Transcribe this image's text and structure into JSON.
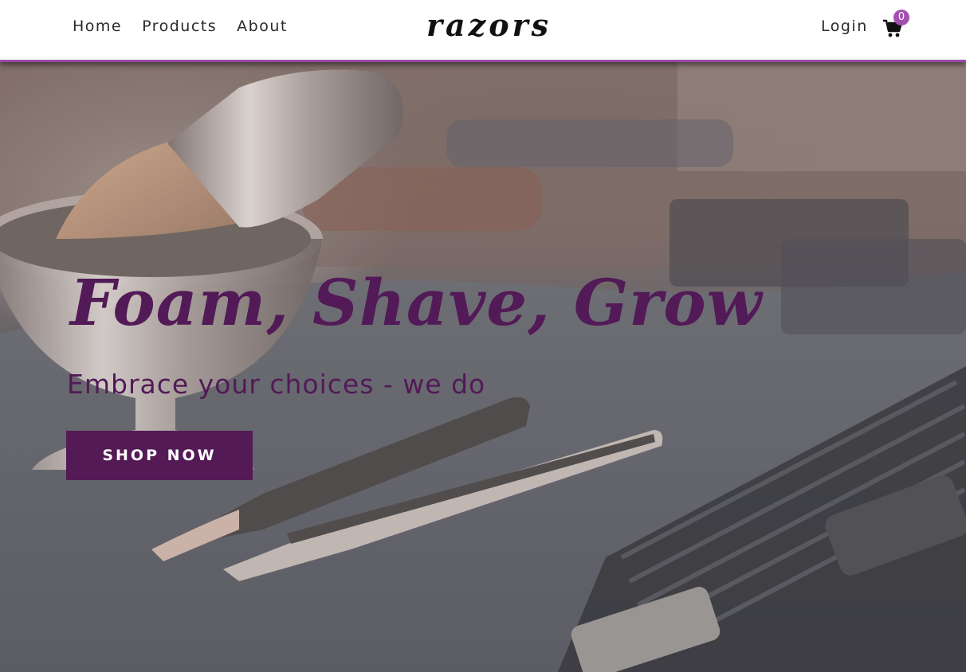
{
  "nav": {
    "links": [
      "Home",
      "Products",
      "About"
    ],
    "brand": "razors",
    "login": "Login",
    "cart_count": "0"
  },
  "hero": {
    "headline": "Foam, Shave, Grow",
    "subheadline": "Embrace your choices - we do",
    "cta": "SHOP NOW"
  },
  "colors": {
    "accent": "#531a56",
    "badge": "#a34fb0",
    "nav_border": "#9b4aa8"
  },
  "icons": [
    "shopping-cart-icon"
  ]
}
